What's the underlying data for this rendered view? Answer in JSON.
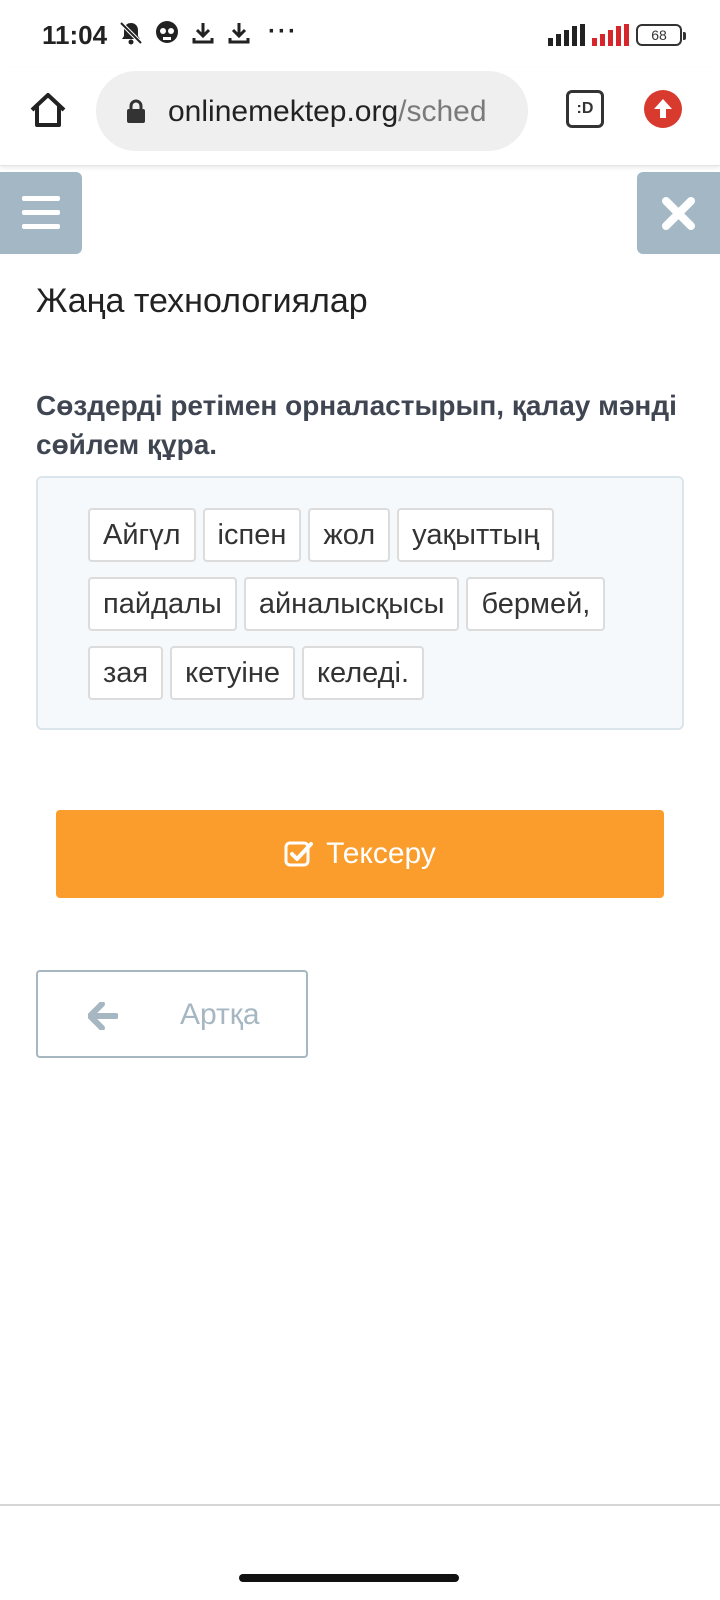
{
  "status_bar": {
    "time": "11:04",
    "icons": [
      "muted-bell-icon",
      "ghost-icon",
      "download-icon",
      "download-icon"
    ],
    "more": "···",
    "battery": "68"
  },
  "browser": {
    "url_domain": "onlinemektep.org",
    "url_path": "/sched",
    "tab_label": ":D"
  },
  "page": {
    "title": "Жаңа технологиялар",
    "instruction": "Сөздерді ретімен орналастырып, қалау мәнді сөйлем құра.",
    "word_rows": [
      [
        "Айгүл",
        "іспен",
        "жол",
        "уақыттың"
      ],
      [
        "пайдалы",
        "айналысқысы",
        "бермей,"
      ],
      [
        "зая",
        "кетуіне",
        "келеді."
      ]
    ],
    "check_button": "Тексеру",
    "back_button": "Артқа"
  },
  "colors": {
    "accent_orange": "#fb9d2c",
    "chrome_gray_blue": "#a3b8c4",
    "update_red": "#d93a2e"
  }
}
